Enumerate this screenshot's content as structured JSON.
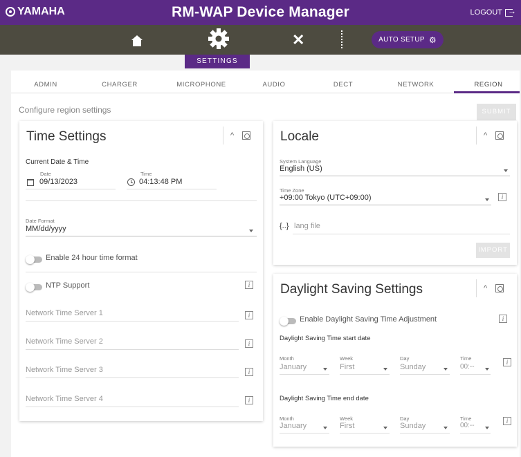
{
  "header": {
    "brand": "YAMAHA",
    "app_title": "RM-WAP Device Manager",
    "logout_label": "LOGOUT",
    "auto_setup_label": "AUTO SETUP",
    "active_section": "SETTINGS"
  },
  "tabs": [
    {
      "label": "ADMIN"
    },
    {
      "label": "CHARGER"
    },
    {
      "label": "MICROPHONE"
    },
    {
      "label": "AUDIO"
    },
    {
      "label": "DECT"
    },
    {
      "label": "NETWORK"
    },
    {
      "label": "REGION",
      "active": true
    }
  ],
  "page": {
    "caption": "Configure region settings",
    "submit_label": "SUBMIT"
  },
  "time_settings": {
    "title": "Time Settings",
    "current_heading": "Current Date & Time",
    "date_label": "Date",
    "date_value": "09/13/2023",
    "time_label": "Time",
    "time_value": "04:13:48 PM",
    "date_format_label": "Date Format",
    "date_format_value": "MM/dd/yyyy",
    "enable_24h_label": "Enable 24 hour time format",
    "enable_24h_on": false,
    "ntp_label": "NTP Support",
    "ntp_on": false,
    "ntp_servers": [
      {
        "placeholder": "Network Time Server 1"
      },
      {
        "placeholder": "Network Time Server 2"
      },
      {
        "placeholder": "Network Time Server 3"
      },
      {
        "placeholder": "Network Time Server 4"
      }
    ]
  },
  "locale": {
    "title": "Locale",
    "language_label": "System Language",
    "language_value": "English (US)",
    "timezone_label": "Time Zone",
    "timezone_value": "+09:00 Tokyo (UTC+09:00)",
    "lang_file_icon": "{..}",
    "lang_file_placeholder": "lang file",
    "import_label": "IMPORT"
  },
  "dst": {
    "title": "Daylight Saving Settings",
    "enable_label": "Enable Daylight Saving Time Adjustment",
    "enable_on": false,
    "start_heading": "Daylight Saving Time start date",
    "end_heading": "Daylight Saving Time end date",
    "month_label": "Month",
    "week_label": "Week",
    "day_label": "Day",
    "time_label": "Time",
    "start": {
      "month": "January",
      "week": "First",
      "day": "Sunday",
      "time": "00:--"
    },
    "end": {
      "month": "January",
      "week": "First",
      "day": "Sunday",
      "time": "00:--"
    }
  },
  "colors": {
    "brand_purple": "#5b2a86",
    "nav_dark": "#4d4b40",
    "disabled_button": "#e3e3e3"
  }
}
